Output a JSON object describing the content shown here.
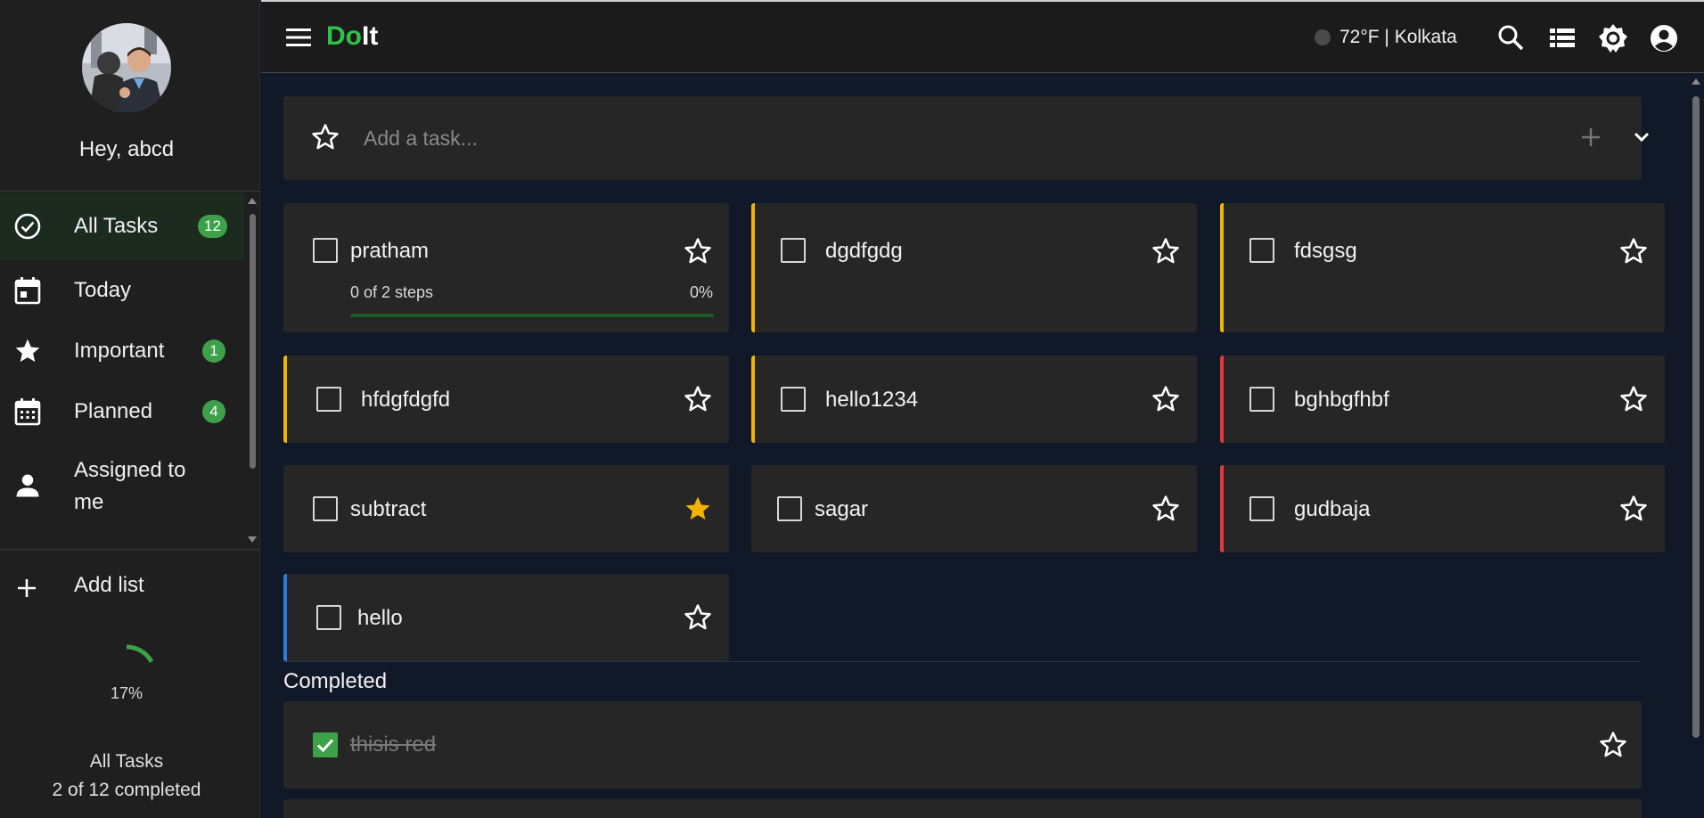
{
  "app": {
    "brand_do": "Do",
    "brand_it": "It"
  },
  "sidebar": {
    "greeting": "Hey, abcd",
    "items": [
      {
        "label": "All Tasks",
        "icon": "check-circle-icon",
        "badge": "12"
      },
      {
        "label": "Today",
        "icon": "calendar-today-icon",
        "badge": ""
      },
      {
        "label": "Important",
        "icon": "star-icon",
        "badge": "1"
      },
      {
        "label": "Planned",
        "icon": "calendar-grid-icon",
        "badge": "4"
      },
      {
        "label": "Assigned to",
        "label2": "me",
        "icon": "person-icon",
        "badge": ""
      }
    ],
    "add_list": "Add list",
    "progress_percent": "17%",
    "progress_value": 0.17,
    "footer_title": "All Tasks",
    "footer_count": "2 of 12 completed"
  },
  "header": {
    "weather": "72°F | Kolkata",
    "icons": [
      "search-icon",
      "list-view-icon",
      "theme-icon",
      "account-icon"
    ]
  },
  "add_task": {
    "placeholder": "Add a task..."
  },
  "tasks": [
    {
      "title": "pratham",
      "accent": "",
      "important": false,
      "steps": "0 of 2 steps",
      "steps_pct": "0%"
    },
    {
      "title": "dgdfgdg",
      "accent": "#f2b400",
      "important": false
    },
    {
      "title": "fdsgsg",
      "accent": "#f2b400",
      "important": false
    },
    {
      "title": "hfdgfdgfd",
      "accent": "#f2b400",
      "important": false
    },
    {
      "title": "hello1234",
      "accent": "#f2b400",
      "important": false
    },
    {
      "title": "bghbgfhbf",
      "accent": "#e53935",
      "important": false
    },
    {
      "title": "subtract",
      "accent": "",
      "important": true
    },
    {
      "title": "sagar",
      "accent": "",
      "important": false
    },
    {
      "title": "gudbaja",
      "accent": "#e53935",
      "important": false
    },
    {
      "title": "hello",
      "accent": "#2f7ae5",
      "important": false
    }
  ],
  "completed": {
    "label": "Completed",
    "items": [
      {
        "title": "thisis red"
      }
    ]
  },
  "colors": {
    "accent_green": "#3da14a",
    "star_yellow": "#f2b400",
    "bg": "#111827",
    "card": "#262626"
  }
}
